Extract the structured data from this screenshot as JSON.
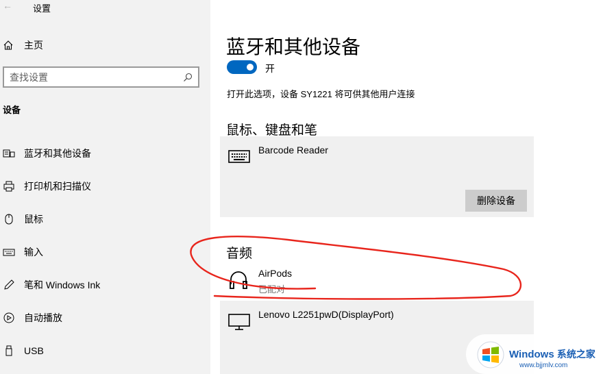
{
  "window": {
    "back_glyph": "←",
    "title": "设置"
  },
  "sidebar": {
    "home_label": "主页",
    "search_placeholder": "查找设置",
    "group_label": "设备",
    "items": [
      {
        "label": "蓝牙和其他设备",
        "icon": "bluetooth-devices-icon"
      },
      {
        "label": "打印机和扫描仪",
        "icon": "printer-icon"
      },
      {
        "label": "鼠标",
        "icon": "mouse-icon"
      },
      {
        "label": "输入",
        "icon": "keyboard-icon"
      },
      {
        "label": "笔和 Windows Ink",
        "icon": "pen-icon"
      },
      {
        "label": "自动播放",
        "icon": "autoplay-icon"
      },
      {
        "label": "USB",
        "icon": "usb-icon"
      }
    ]
  },
  "main": {
    "title": "蓝牙和其他设备",
    "toggle_label": "开",
    "toggle_on": true,
    "description": "打开此选项，设备 SY1221 将可供其他用户连接",
    "sections": [
      {
        "title": "鼠标、键盘和笔",
        "devices": [
          {
            "name": "Barcode Reader",
            "icon": "keyboard-icon",
            "button": "删除设备"
          }
        ]
      },
      {
        "title": "音频",
        "devices": [
          {
            "name": "AirPods",
            "status": "已配对",
            "icon": "headphones-icon"
          },
          {
            "name": "Lenovo L2251pwD(DisplayPort)",
            "icon": "monitor-icon"
          }
        ]
      }
    ]
  },
  "watermark": {
    "brand": "Windows",
    "brand_cn": "系统之家",
    "url": "www.bjjmlv.com"
  },
  "colors": {
    "accent": "#0067c0",
    "annotation": "#e8251c"
  }
}
